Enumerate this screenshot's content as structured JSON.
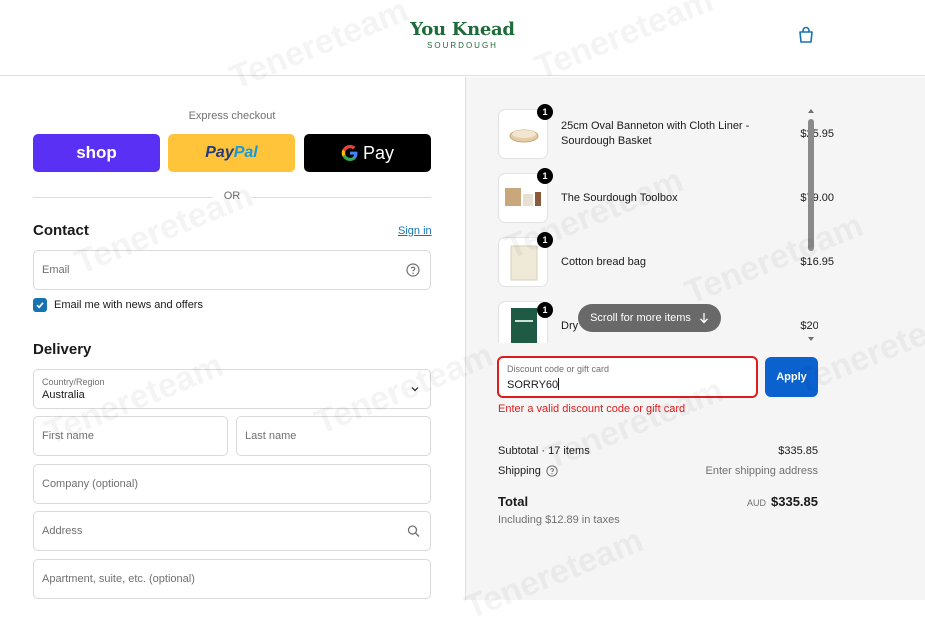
{
  "header": {
    "logo_main": "You Knead",
    "logo_sub": "SOURDOUGH",
    "cart_icon": "shopping-bag-icon"
  },
  "express": {
    "label": "Express checkout",
    "shop": "shop",
    "paypal_1": "Pay",
    "paypal_2": "Pal",
    "gpay": "Pay",
    "or": "OR"
  },
  "contact": {
    "title": "Contact",
    "signin": "Sign in",
    "email_placeholder": "Email",
    "newsletter_label": "Email me with news and offers",
    "newsletter_checked": true
  },
  "delivery": {
    "title": "Delivery",
    "country_label": "Country/Region",
    "country_value": "Australia",
    "first_name": "First name",
    "last_name": "Last name",
    "company": "Company (optional)",
    "address": "Address",
    "apartment": "Apartment, suite, etc. (optional)"
  },
  "order": {
    "items": [
      {
        "name": "25cm Oval Banneton with Cloth Liner - Sourdough Basket",
        "price": "$25.95",
        "qty": "1"
      },
      {
        "name": "The Sourdough Toolbox",
        "price": "$79.00",
        "qty": "1"
      },
      {
        "name": "Cotton bread bag",
        "price": "$16.95",
        "qty": "1"
      },
      {
        "name": "Dry",
        "price": "$20.00",
        "qty": "1"
      }
    ],
    "scroll_hint": "Scroll for more items"
  },
  "discount": {
    "label": "Discount code or gift card",
    "value": "SORRY60",
    "apply": "Apply",
    "error": "Enter a valid discount code or gift card"
  },
  "summary": {
    "subtotal_label": "Subtotal · 17 items",
    "subtotal_value": "$335.85",
    "shipping_label": "Shipping",
    "shipping_value": "Enter shipping address",
    "total_label": "Total",
    "currency": "AUD",
    "total_value": "$335.85",
    "taxes": "Including $12.89 in taxes"
  },
  "watermark": "Tenereteam",
  "colors": {
    "brand": "#1d6b3a",
    "accent": "#0b62cf",
    "error": "#dd1d1d",
    "shop": "#5a31f4",
    "paypal": "#ffc439"
  }
}
